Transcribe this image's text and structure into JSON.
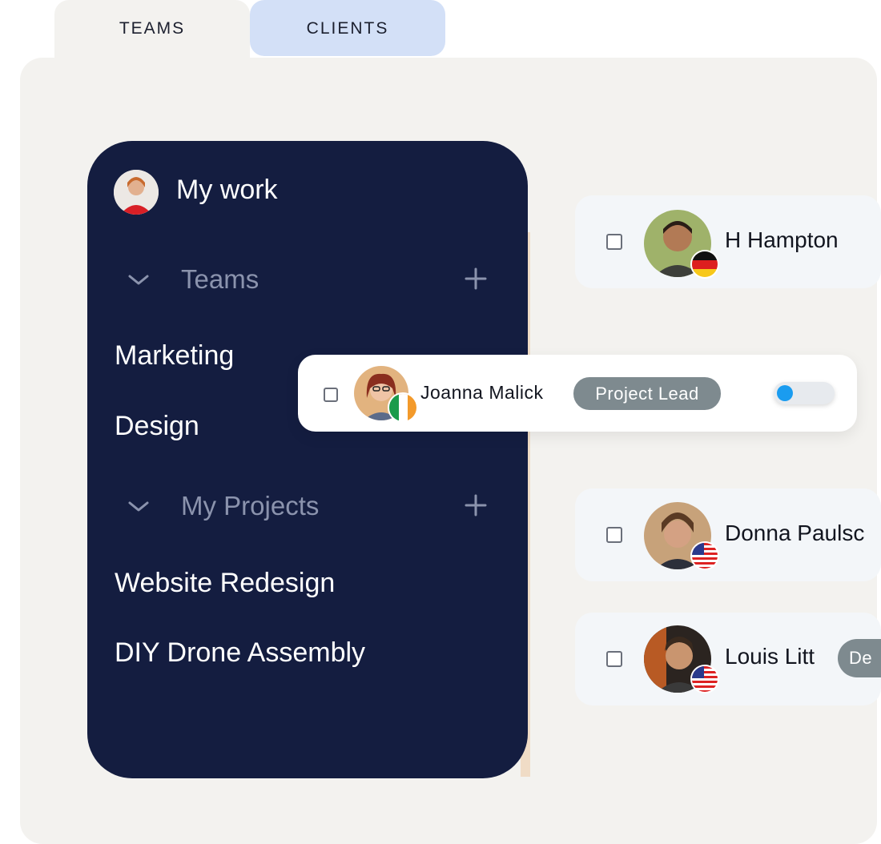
{
  "tabs": [
    {
      "label": "TEAMS"
    },
    {
      "label": "CLIENTS"
    }
  ],
  "sidebar": {
    "my_work_label": "My work",
    "sections": [
      {
        "label": "Teams",
        "items": [
          "Marketing",
          "Design"
        ]
      },
      {
        "label": "My Projects",
        "items": [
          "Website Redesign",
          "DIY Drone Assembly"
        ]
      }
    ]
  },
  "people": [
    {
      "name": "H Hampton",
      "flag": "germany-flag-icon"
    },
    {
      "name": "Joanna Malick",
      "role": "Project Lead",
      "flag": "ireland-flag-icon",
      "toggle_on": true
    },
    {
      "name": "Donna Paulsc",
      "flag": "usa-flag-icon"
    },
    {
      "name": "Louis Litt",
      "role": "De",
      "flag": "usa-flag-icon"
    }
  ],
  "colors": {
    "sidebar_bg": "#141d40",
    "panel_bg": "#f3f2ef",
    "clients_tab_bg": "#d3e0f7",
    "badge_bg": "#7e8a8f",
    "toggle_knob": "#1a9cf0"
  }
}
